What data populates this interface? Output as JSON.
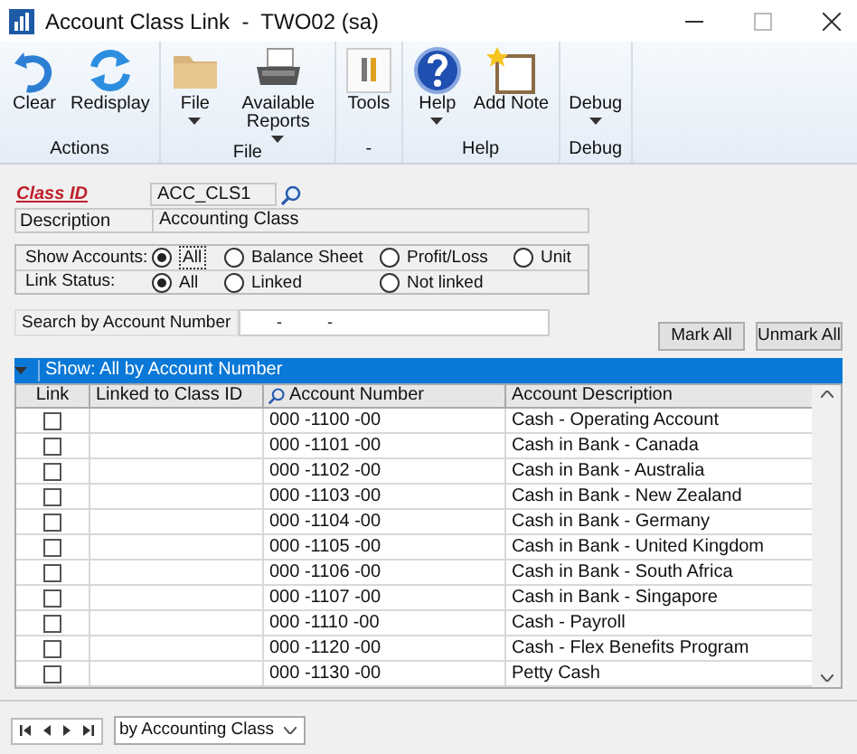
{
  "window": {
    "title": "Account Class Link  -  TWO02 (sa)"
  },
  "ribbon": [
    {
      "label": "Actions",
      "buttons": [
        {
          "label": "Clear",
          "dropdown": false
        },
        {
          "label": "Redisplay",
          "dropdown": false
        }
      ]
    },
    {
      "label": "File",
      "buttons": [
        {
          "label": "File",
          "dropdown": true
        },
        {
          "label": "Available Reports",
          "dropdown": true
        }
      ]
    },
    {
      "label": "-",
      "buttons": [
        {
          "label": "Tools",
          "dropdown": false
        }
      ]
    },
    {
      "label": "Help",
      "buttons": [
        {
          "label": "Help",
          "dropdown": true
        },
        {
          "label": "Add Note",
          "dropdown": false
        }
      ]
    },
    {
      "label": "Debug",
      "buttons": [
        {
          "label": "Debug",
          "dropdown": true
        }
      ]
    }
  ],
  "class_id": {
    "label": "Class ID",
    "value": "ACC_CLS1"
  },
  "description": {
    "label": "Description",
    "value": "Accounting Class"
  },
  "show_accounts": {
    "label": "Show Accounts:",
    "options": [
      {
        "label": "All",
        "selected": true
      },
      {
        "label": "Balance Sheet",
        "selected": false
      },
      {
        "label": "Profit/Loss",
        "selected": false
      },
      {
        "label": "Unit",
        "selected": false
      }
    ]
  },
  "link_status": {
    "label": "Link Status:",
    "options": [
      {
        "label": "All",
        "selected": true
      },
      {
        "label": "Linked",
        "selected": false
      },
      {
        "label": "Not linked",
        "selected": false
      }
    ]
  },
  "search": {
    "label": "Search by Account Number",
    "value": "-          -"
  },
  "buttons": [
    "Mark All",
    "Unmark All"
  ],
  "table": {
    "title": "Show: All by Account Number",
    "columns": [
      "Link",
      "Linked to Class ID",
      "Account Number",
      "Account Description"
    ],
    "rows": [
      {
        "checked": false,
        "number": "000 -1100 -00",
        "description": "Cash - Operating Account"
      },
      {
        "checked": false,
        "number": "000 -1101 -00",
        "description": "Cash in Bank - Canada"
      },
      {
        "checked": false,
        "number": "000 -1102 -00",
        "description": "Cash in Bank - Australia"
      },
      {
        "checked": false,
        "number": "000 -1103 -00",
        "description": "Cash in Bank - New Zealand"
      },
      {
        "checked": false,
        "number": "000 -1104 -00",
        "description": "Cash in Bank - Germany"
      },
      {
        "checked": false,
        "number": "000 -1105 -00",
        "description": "Cash in Bank - United Kingdom"
      },
      {
        "checked": false,
        "number": "000 -1106 -00",
        "description": "Cash in Bank - South Africa"
      },
      {
        "checked": false,
        "number": "000 -1107 -00",
        "description": "Cash in Bank - Singapore"
      },
      {
        "checked": false,
        "number": "000 -1110 -00",
        "description": "Cash - Payroll"
      },
      {
        "checked": false,
        "number": "000 -1120 -00",
        "description": "Cash - Flex Benefits Program"
      },
      {
        "checked": false,
        "number": "000 -1130 -00",
        "description": "Petty Cash"
      }
    ]
  },
  "footer": {
    "sort": "by Accounting Class"
  }
}
